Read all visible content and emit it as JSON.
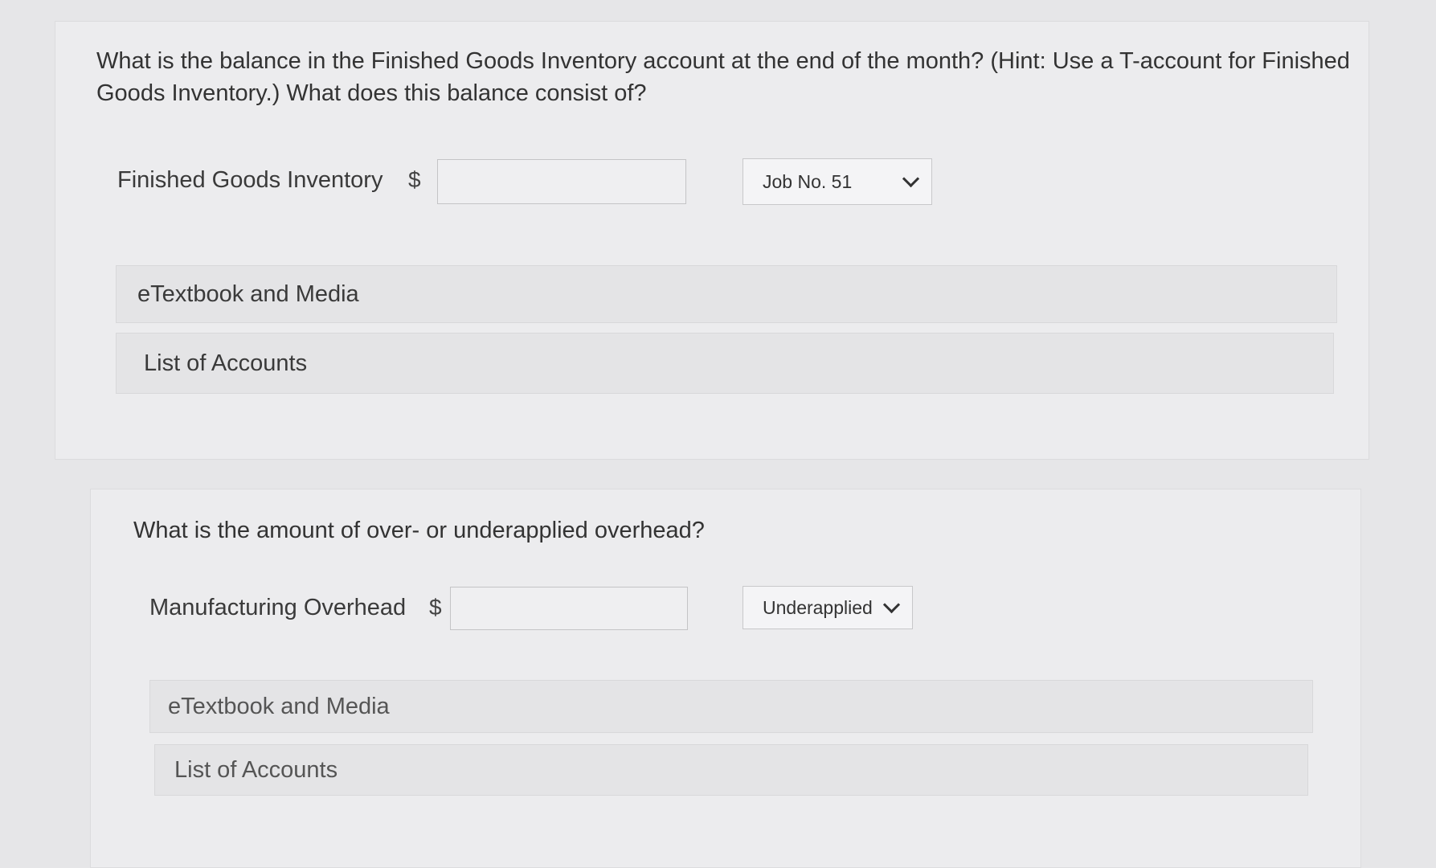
{
  "section1": {
    "question": "What is the balance in the Finished Goods Inventory account at the end of the month? (Hint: Use a T-account for Finished Goods Inventory.) What does this balance consist of?",
    "field_label": "Finished Goods Inventory",
    "currency": "$",
    "amount_value": "",
    "select_value": "Job No. 51",
    "panel1_label": "eTextbook and Media",
    "panel2_label": "List of Accounts"
  },
  "section2": {
    "question": "What is the amount of over- or underapplied overhead?",
    "field_label": "Manufacturing Overhead",
    "currency": "$",
    "amount_value": "",
    "select_value": "Underapplied",
    "panel1_label": "eTextbook and Media",
    "panel2_label": "List of Accounts"
  }
}
